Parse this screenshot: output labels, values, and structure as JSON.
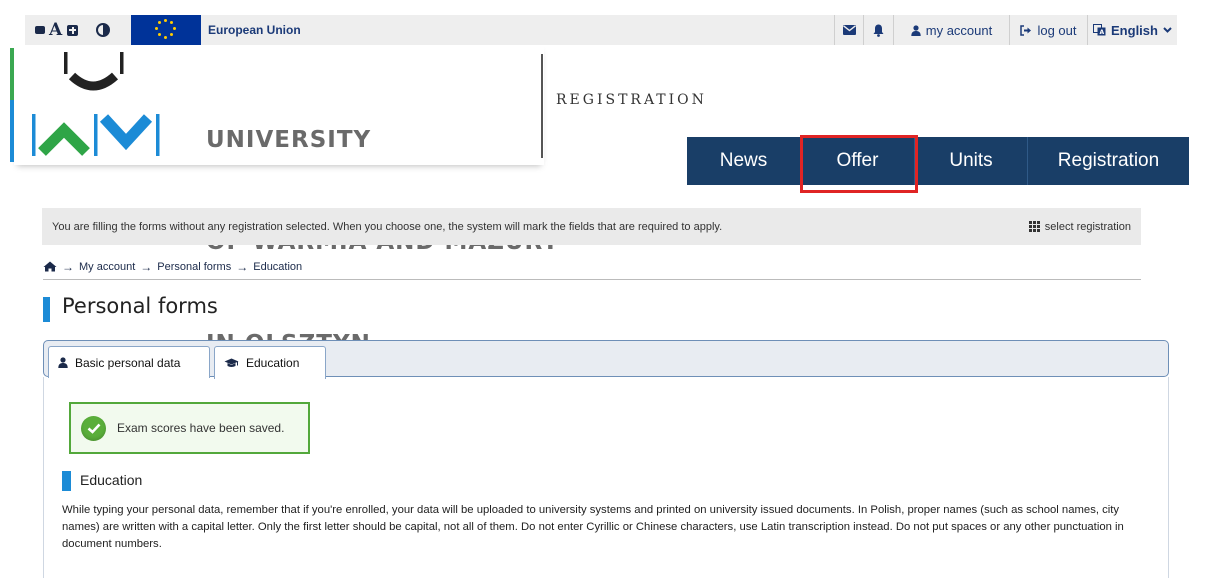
{
  "topbar": {
    "accessibility": {
      "decrease_icon": "minus-square-icon",
      "font_letter": "A",
      "increase_icon": "plus-square-icon",
      "contrast_icon": "contrast-icon"
    },
    "eu_label": "European Union",
    "mail_icon": "envelope-icon",
    "bell_icon": "bell-icon",
    "my_account": "my account",
    "log_out": "log out",
    "language": "English"
  },
  "header": {
    "university_lines": [
      "UNIVERSITY",
      "OF WARMIA AND MAZURY",
      "IN OLSZTYN"
    ],
    "app_title": "REGISTRATION"
  },
  "nav": {
    "items": [
      {
        "label": "News"
      },
      {
        "label": "Offer"
      },
      {
        "label": "Units"
      },
      {
        "label": "Registration"
      }
    ]
  },
  "notice": {
    "text": "You are filling the forms without any registration selected. When you choose one, the system will mark the fields that are required to apply.",
    "select_label": "select registration"
  },
  "breadcrumb": {
    "home_icon": "home-icon",
    "items": [
      "My account",
      "Personal forms",
      "Education"
    ],
    "separator": "→"
  },
  "page": {
    "title": "Personal forms"
  },
  "tabs": [
    {
      "label": "Basic personal data",
      "icon": "user-icon"
    },
    {
      "label": "Education",
      "icon": "graduation-cap-icon"
    }
  ],
  "alert": {
    "text": "Exam scores have been saved."
  },
  "section": {
    "title": "Education",
    "paragraph": "While typing your personal data, remember that if you're enrolled, your data will be uploaded to university systems and printed on university issued documents. In Polish, proper names (such as school names, city names) are written with a capital letter. Only the first letter should be capital, not all of them. Do not enter Cyrillic or Chinese characters, use Latin transcription instead. Do not put spaces or any other punctuation in document numbers."
  },
  "colors": {
    "nav_bg": "#193e67",
    "accent_blue": "#1c8bd6",
    "accent_green": "#3aa851",
    "success_border": "#53a83b",
    "highlight": "#e02424",
    "eu_blue": "#003399"
  }
}
